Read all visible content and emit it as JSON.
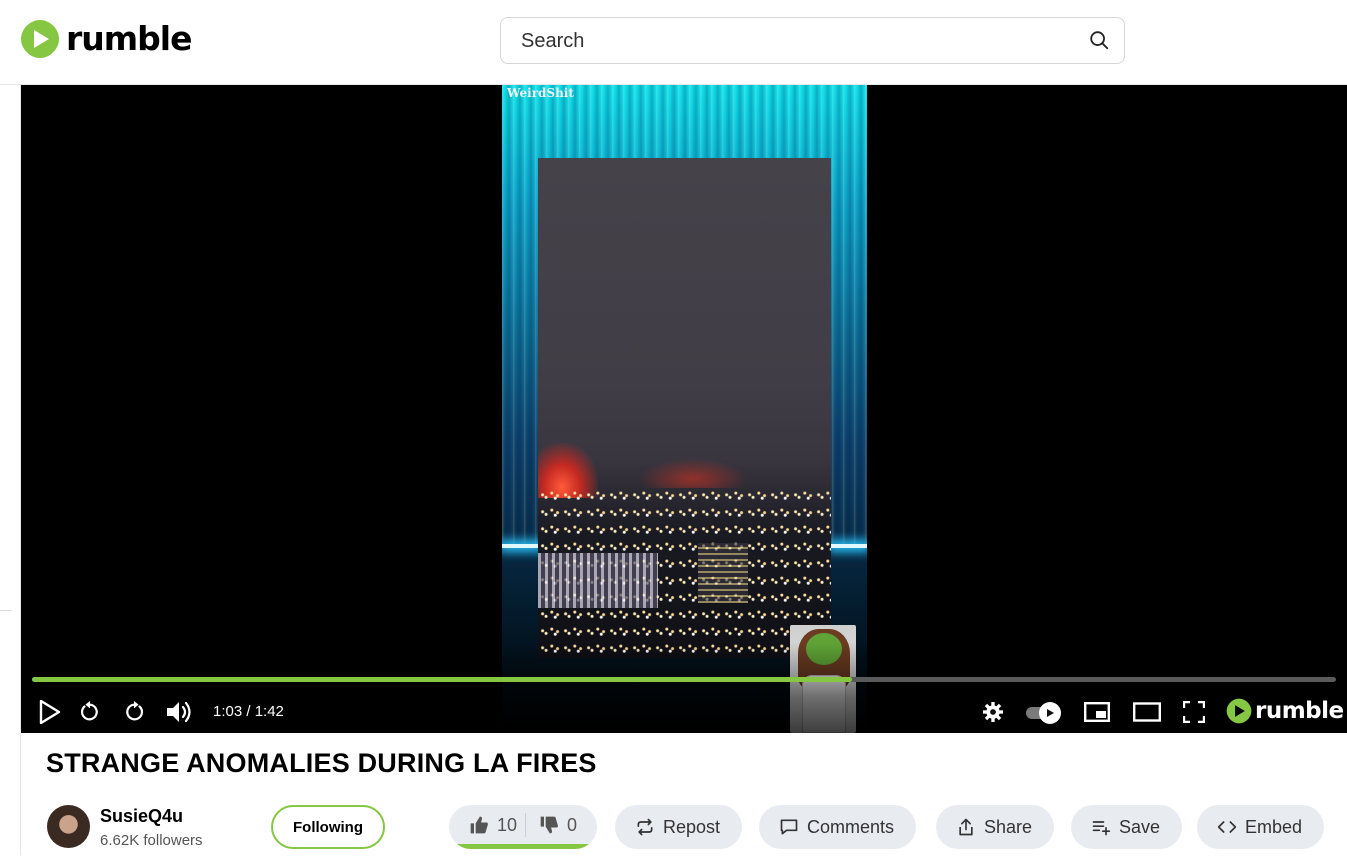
{
  "header": {
    "logo_text": "rumble",
    "search_placeholder": "Search"
  },
  "player": {
    "watermark": "WeirdShit",
    "time": "1:03 / 1:42",
    "progress_fraction": 0.629,
    "logo_text": "rumble"
  },
  "video": {
    "title": "STRANGE ANOMALIES DURING LA FIRES",
    "channel_name": "SusieQ4u",
    "followers": "6.62K followers",
    "follow_label": "Following",
    "likes": "10",
    "dislikes": "0",
    "like_fraction": 1.0,
    "actions": {
      "repost": "Repost",
      "comments": "Comments",
      "share": "Share",
      "save": "Save",
      "embed": "Embed"
    }
  },
  "colors": {
    "brand_green": "#85c742",
    "pill_bg": "#e8ecf1"
  }
}
